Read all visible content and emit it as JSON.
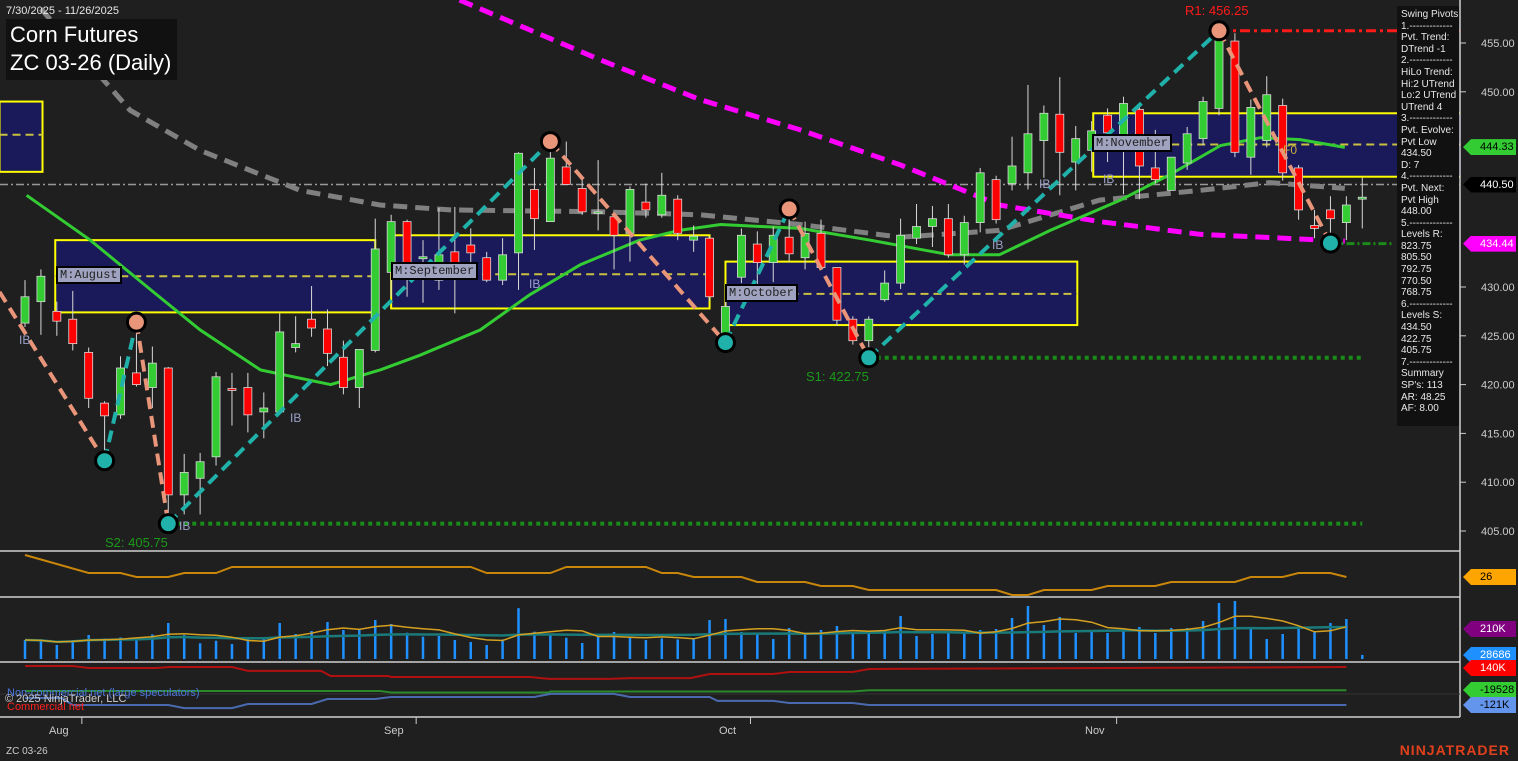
{
  "header": {
    "date_range": "7/30/2025 - 11/26/2025",
    "title": "Corn Futures",
    "subtitle": "ZC 03-26 (Daily)"
  },
  "swing_panel": {
    "lines": [
      "Swing Pivots",
      "1.-------------",
      "Pvt. Trend:",
      "DTrend -1",
      "2.-------------",
      "HiLo Trend:",
      "Hi:2 UTrend",
      "Lo:2 UTrend",
      "UTrend 4",
      "3.-------------",
      "Pvt. Evolve:",
      "Pvt Low",
      "434.50",
      "D: 7",
      "4.-------------",
      "Pvt. Next:",
      "Pvt High",
      "448.00",
      "5.-------------",
      "Levels R:",
      "823.75",
      "805.50",
      "792.75",
      "770.50",
      "768.75",
      "6.-------------",
      "Levels S:",
      "434.50",
      "422.75",
      "405.75",
      "7.-------------",
      "Summary",
      "SP's: 113",
      "AR: 48.25",
      "AF: 8.00"
    ]
  },
  "labels": {
    "r1": "R1: 456.25",
    "s1": "S1: 422.75",
    "s2": "S2: 405.75",
    "ib": "IB",
    "f0": "F0"
  },
  "price_tags": [
    {
      "text": "444.33",
      "value": 444.33,
      "bg": "#33cc33",
      "fg": "#000000"
    },
    {
      "text": "440.50",
      "value": 440.5,
      "bg": "#000000",
      "fg": "#ffffff"
    },
    {
      "text": "434.44",
      "value": 434.44,
      "bg": "#ff00ff",
      "fg": "#ffffff"
    }
  ],
  "indicator_tags": [
    {
      "text": "26",
      "bg": "#ffa500",
      "fg": "#000000"
    },
    {
      "text": "210K",
      "bg": "#800080",
      "fg": "#ffffff"
    },
    {
      "text": "28686",
      "bg": "#1e90ff",
      "fg": "#ffffff"
    },
    {
      "text": "140K",
      "bg": "#ff0000",
      "fg": "#ffffff"
    },
    {
      "text": "-19528",
      "bg": "#33cc33",
      "fg": "#000000"
    },
    {
      "text": "-121K",
      "bg": "#6495ed",
      "fg": "#000000"
    }
  ],
  "legend": {
    "noncommercial": "Non-commercial net (large speculators)",
    "commercial": "Commercial net",
    "copyright": "© 2025 NinjaTrader, LLC"
  },
  "footer": {
    "instrument": "ZC 03-26",
    "brand": "NINJATRADER"
  },
  "colors": {
    "up": "#33cc33",
    "down": "#ff0000",
    "box": "#1a1a5a",
    "box_border": "#ffff00",
    "pivot_up_line": "#20b2aa",
    "pivot_down_line": "#e8957a",
    "ma_fast": "#33cc33",
    "ma_mid": "#808080",
    "ma_slow": "#ff00ff"
  },
  "chart_data": {
    "type": "candlestick",
    "title": "Corn Futures ZC 03-26 (Daily)",
    "y_ticks": [
      455,
      450,
      430,
      425,
      420,
      415,
      410,
      405
    ],
    "y_tick_labels": [
      "455.00",
      "450.00",
      "430.00",
      "425.00",
      "420.00",
      "415.00",
      "410.00",
      "405.00"
    ],
    "x_month_labels": [
      {
        "label": "Aug",
        "index": 2
      },
      {
        "label": "Sep",
        "index": 23
      },
      {
        "label": "Oct",
        "index": 44
      },
      {
        "label": "Nov",
        "index": 67
      }
    ],
    "ohlc": [
      [
        426.3,
        430.7,
        425.9,
        429
      ],
      [
        428.5,
        431.8,
        425.1,
        431.1
      ],
      [
        427.5,
        428.5,
        425,
        426.5
      ],
      [
        426.7,
        429.6,
        423.5,
        424.2
      ],
      [
        423.3,
        423.8,
        417.6,
        418.6
      ],
      [
        418.1,
        418.3,
        412.2,
        416.8
      ],
      [
        416.9,
        422.9,
        416.5,
        421.7
      ],
      [
        421.2,
        426.4,
        419.8,
        420.0
      ],
      [
        419.7,
        423.9,
        417.6,
        422.2
      ],
      [
        421.7,
        421.8,
        405.9,
        408.7
      ],
      [
        408.7,
        412.9,
        406.7,
        411.0
      ],
      [
        410.4,
        413.0,
        406.7,
        412.1
      ],
      [
        412.6,
        421.3,
        411.7,
        420.8
      ],
      [
        419.6,
        421.2,
        415.8,
        419.4
      ],
      [
        419.7,
        421.2,
        415.1,
        416.9
      ],
      [
        417.2,
        419.2,
        414.5,
        417.6
      ],
      [
        417.2,
        427.3,
        417.2,
        425.4
      ],
      [
        423.8,
        427.0,
        423.3,
        424.2
      ],
      [
        426.7,
        430.1,
        424.9,
        425.8
      ],
      [
        425.7,
        427.7,
        421.9,
        423.2
      ],
      [
        422.8,
        424.5,
        419.0,
        419.7
      ],
      [
        419.7,
        423.5,
        417.6,
        423.6
      ],
      [
        423.5,
        437.0,
        423.3,
        433.9
      ],
      [
        431.5,
        437.4,
        429.0,
        436.7
      ],
      [
        436.7,
        436.9,
        429.0,
        431.5
      ],
      [
        432.9,
        434.8,
        428.4,
        433.1
      ],
      [
        430.7,
        438.1,
        429.7,
        433.3
      ],
      [
        433.6,
        438.2,
        427.3,
        431.4
      ],
      [
        434.3,
        436.0,
        432.1,
        433.5
      ],
      [
        433.0,
        433.6,
        430.5,
        430.7
      ],
      [
        430.7,
        435.0,
        430.2,
        433.3
      ],
      [
        433.5,
        443.8,
        429.7,
        443.7
      ],
      [
        440.0,
        442.2,
        433.8,
        437.0
      ],
      [
        436.7,
        444.9,
        436.7,
        443.2
      ],
      [
        442.3,
        444.9,
        440.9,
        440.5
      ],
      [
        440.1,
        441.1,
        437.4,
        437.7
      ],
      [
        437.6,
        443.0,
        435.8,
        437.7
      ],
      [
        437.2,
        437.6,
        431.8,
        435.3
      ],
      [
        435.5,
        440.3,
        432.6,
        440.0
      ],
      [
        438.7,
        440.6,
        437.1,
        437.9
      ],
      [
        437.4,
        441.7,
        437.1,
        439.4
      ],
      [
        439.0,
        439.4,
        434.8,
        435.5
      ],
      [
        434.8,
        436.3,
        433.6,
        435.2
      ],
      [
        435.0,
        435.2,
        428.6,
        429.0
      ],
      [
        424.6,
        430.0,
        424.3,
        428.0
      ],
      [
        431.0,
        436.0,
        430.4,
        435.3
      ],
      [
        434.4,
        435.7,
        430.2,
        432.5
      ],
      [
        432.5,
        436.2,
        430.5,
        435.3
      ],
      [
        435.1,
        438.0,
        432.6,
        433.4
      ],
      [
        433.0,
        436.7,
        431.8,
        435.5
      ],
      [
        435.5,
        436.9,
        431.8,
        432.0
      ],
      [
        432.0,
        432.0,
        426.0,
        426.6
      ],
      [
        426.7,
        427.0,
        424.1,
        424.5
      ],
      [
        424.5,
        427.0,
        422.75,
        426.7
      ],
      [
        428.7,
        431.7,
        428.5,
        430.4
      ],
      [
        430.4,
        437.0,
        429.8,
        435.3
      ],
      [
        435.0,
        438.5,
        434.4,
        436.2
      ],
      [
        436.2,
        438.3,
        434.1,
        437.0
      ],
      [
        437.0,
        438.5,
        433.0,
        433.3
      ],
      [
        433.3,
        437.3,
        432.3,
        436.6
      ],
      [
        436.6,
        442.2,
        435.6,
        441.7
      ],
      [
        441.0,
        441.4,
        436.5,
        436.9
      ],
      [
        440.6,
        445.4,
        439.9,
        442.4
      ],
      [
        441.7,
        450.7,
        440.0,
        445.7
      ],
      [
        445.0,
        448.6,
        441.2,
        447.8
      ],
      [
        447.7,
        451.5,
        439.4,
        443.8
      ],
      [
        442.8,
        446.5,
        439.9,
        445.2
      ],
      [
        444.0,
        447.0,
        441.8,
        446.0
      ],
      [
        447.6,
        448.3,
        442.8,
        445.8
      ],
      [
        445.4,
        449.5,
        439.5,
        448.8
      ],
      [
        448.2,
        448.4,
        439.0,
        442.4
      ],
      [
        442.2,
        446.1,
        440.6,
        441.0
      ],
      [
        439.9,
        443.3,
        439.9,
        443.3
      ],
      [
        442.7,
        446.4,
        442.0,
        445.7
      ],
      [
        445.2,
        449.5,
        444.5,
        449.0
      ],
      [
        448.3,
        456.5,
        447.6,
        455.3
      ],
      [
        455.2,
        456.0,
        443.3,
        443.8
      ],
      [
        443.3,
        449.2,
        441.5,
        448.4
      ],
      [
        445.0,
        451.6,
        444.3,
        449.7
      ],
      [
        448.6,
        449.3,
        440.9,
        441.7
      ],
      [
        442.2,
        442.5,
        436.9,
        437.9
      ],
      [
        436.3,
        437.9,
        435.0,
        436.0
      ],
      [
        437.9,
        439.3,
        434.5,
        437.0
      ],
      [
        436.6,
        439.3,
        434.8,
        438.4
      ],
      [
        439.0,
        441.2,
        436.0,
        439.2
      ]
    ],
    "swing_zigzag": [
      [
        -1.6,
        429.5
      ],
      [
        5,
        412.2
      ],
      [
        7,
        426.4
      ],
      [
        9,
        405.75
      ],
      [
        33,
        444.9
      ],
      [
        44,
        424.3
      ],
      [
        48,
        438.0
      ],
      [
        53,
        422.75
      ],
      [
        75,
        456.25
      ],
      [
        82,
        434.5
      ]
    ],
    "ma_fast": [
      [
        0.1,
        439.4
      ],
      [
        4.1,
        434.8
      ],
      [
        7.9,
        429.7
      ],
      [
        11,
        425.6
      ],
      [
        14.8,
        421.5
      ],
      [
        19.2,
        420
      ],
      [
        22.3,
        421.5
      ],
      [
        24.8,
        423
      ],
      [
        28.6,
        425.6
      ],
      [
        31.7,
        429.2
      ],
      [
        34.9,
        432.3
      ],
      [
        38.6,
        434.8
      ],
      [
        41.1,
        435.8
      ],
      [
        43.7,
        436.4
      ],
      [
        48.7,
        436
      ],
      [
        53.1,
        434.8
      ],
      [
        58.1,
        433.3
      ],
      [
        61.2,
        433.3
      ],
      [
        64.4,
        435.8
      ],
      [
        68.8,
        438.9
      ],
      [
        71.9,
        441.5
      ],
      [
        75.1,
        444.5
      ],
      [
        77.6,
        445.3
      ],
      [
        80.1,
        445.1
      ],
      [
        82.9,
        444.3
      ]
    ],
    "ma_mid": [
      [
        1.0,
        458.5
      ],
      [
        2.2,
        456.3
      ],
      [
        6.6,
        448.1
      ],
      [
        11,
        444
      ],
      [
        17.3,
        439.9
      ],
      [
        22.3,
        438.4
      ],
      [
        26.7,
        437.9
      ],
      [
        36.1,
        437.7
      ],
      [
        42.4,
        437.4
      ],
      [
        48.7,
        436.4
      ],
      [
        55,
        435.1
      ],
      [
        61.2,
        435.8
      ],
      [
        67.5,
        438.9
      ],
      [
        73.8,
        439.9
      ],
      [
        78.2,
        440.7
      ],
      [
        82.9,
        440.1
      ]
    ],
    "ma_slow": [
      [
        27.3,
        459.4
      ],
      [
        36.1,
        453.3
      ],
      [
        42.4,
        449.2
      ],
      [
        48.7,
        446.1
      ],
      [
        55,
        442.5
      ],
      [
        61.2,
        438.4
      ],
      [
        67.5,
        436.7
      ],
      [
        73.8,
        435.4
      ],
      [
        82.9,
        434.7
      ]
    ],
    "monthly_boxes": [
      {
        "label": "",
        "start": -1.6,
        "end": 1.1,
        "high": 449.0,
        "low": 441.8,
        "mid": 445.6
      },
      {
        "label": "M:August",
        "start": 1.9,
        "end": 22,
        "high": 434.8,
        "low": 427.4,
        "mid": 431.1
      },
      {
        "label": "M:September",
        "start": 23,
        "end": 43,
        "high": 435.3,
        "low": 427.8,
        "mid": 431.3
      },
      {
        "label": "M:October",
        "start": 44,
        "end": 66.1,
        "high": 432.6,
        "low": 426.1,
        "mid": 429.3
      },
      {
        "label": "M:November",
        "start": 67.1,
        "end": 91.4,
        "high": 447.8,
        "low": 441.3,
        "mid": 444.6
      }
    ],
    "levels": {
      "current": 440.5,
      "r1": 456.25,
      "s1": 422.75,
      "s2": 405.75,
      "pivot_low": 434.44
    },
    "volume_k": [
      133,
      128,
      98,
      133,
      168,
      144,
      151,
      144,
      172,
      252,
      168,
      110,
      128,
      105,
      137,
      144,
      252,
      175,
      196,
      259,
      203,
      203,
      273,
      245,
      184,
      156,
      161,
      133,
      119,
      98,
      137,
      356,
      191,
      175,
      149,
      112,
      161,
      189,
      147,
      133,
      144,
      137,
      145,
      273,
      280,
      189,
      175,
      140,
      217,
      168,
      203,
      231,
      179,
      189,
      196,
      301,
      161,
      175,
      184,
      184,
      203,
      210,
      287,
      371,
      238,
      294,
      182,
      203,
      182,
      196,
      224,
      182,
      217,
      217,
      266,
      392,
      406,
      217,
      140,
      175,
      224,
      196,
      252,
      280,
      28.686
    ],
    "indicator_1": [
      [
        0,
        48
      ],
      [
        4,
        30
      ],
      [
        6,
        30
      ],
      [
        7,
        26
      ],
      [
        9,
        26
      ],
      [
        10,
        30
      ],
      [
        12,
        30
      ],
      [
        13,
        36
      ],
      [
        28,
        36
      ],
      [
        29,
        30
      ],
      [
        33,
        30
      ],
      [
        34,
        36
      ],
      [
        39,
        36
      ],
      [
        40,
        30
      ],
      [
        41,
        30
      ],
      [
        42,
        26
      ],
      [
        45,
        26
      ],
      [
        46,
        21
      ],
      [
        49,
        21
      ],
      [
        50,
        17
      ],
      [
        52,
        17
      ],
      [
        53,
        13
      ],
      [
        61,
        13
      ],
      [
        62,
        8
      ],
      [
        63,
        8
      ],
      [
        64,
        13
      ],
      [
        67,
        13
      ],
      [
        68,
        17
      ],
      [
        71,
        17
      ],
      [
        72,
        21
      ],
      [
        76,
        21
      ],
      [
        77,
        26
      ],
      [
        79,
        26
      ],
      [
        80,
        30
      ],
      [
        82,
        30
      ],
      [
        83,
        26
      ]
    ],
    "cot_commercial_k": [
      [
        0,
        147
      ],
      [
        3,
        147
      ],
      [
        4,
        133
      ],
      [
        8.2,
        133
      ],
      [
        9.1,
        140
      ],
      [
        13,
        140
      ],
      [
        14,
        113
      ],
      [
        18.6,
        113
      ],
      [
        19.2,
        78
      ],
      [
        22.8,
        78
      ],
      [
        23,
        71
      ],
      [
        31.7,
        71
      ],
      [
        32.9,
        58
      ],
      [
        36.7,
        58
      ],
      [
        38,
        64
      ],
      [
        41.8,
        64
      ],
      [
        43,
        92
      ],
      [
        47,
        92
      ],
      [
        48,
        106
      ],
      [
        52,
        106
      ],
      [
        53,
        126
      ],
      [
        83,
        140
      ]
    ],
    "cot_noncommercial_k": [
      [
        0,
        -25
      ],
      [
        22.3,
        -25
      ],
      [
        23,
        -35
      ],
      [
        32.9,
        -35
      ],
      [
        33,
        -28
      ],
      [
        52,
        -28
      ],
      [
        53,
        -19.5
      ],
      [
        83,
        -19.5
      ]
    ],
    "cot_blue_k": [
      [
        0,
        -73
      ],
      [
        2.3,
        -73
      ],
      [
        3,
        -121
      ],
      [
        9,
        -121
      ],
      [
        10,
        -142
      ],
      [
        13,
        -142
      ],
      [
        14,
        -114
      ],
      [
        18,
        -114
      ],
      [
        19,
        -80
      ],
      [
        22,
        -80
      ],
      [
        23,
        -66
      ],
      [
        32,
        -66
      ],
      [
        33,
        -45
      ],
      [
        37,
        -45
      ],
      [
        38,
        -66
      ],
      [
        43,
        -66
      ],
      [
        43.5,
        -93
      ],
      [
        47,
        -93
      ],
      [
        48,
        -107
      ],
      [
        52,
        -107
      ],
      [
        53,
        -121
      ],
      [
        83,
        -121
      ]
    ]
  }
}
